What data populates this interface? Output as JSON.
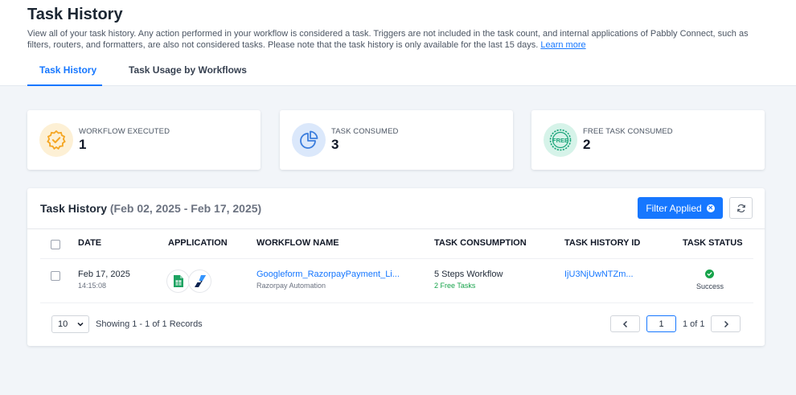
{
  "header": {
    "title": "Task History",
    "description": "View all of your task history. Any action performed in your workflow is considered a task. Triggers are not included in the task count, and internal applications of Pabbly Connect, such as filters, routers, and formatters, are also not considered tasks. Please note that the task history is only available for the last 15 days.",
    "learn_more": "Learn more"
  },
  "tabs": [
    {
      "label": "Task History",
      "active": true
    },
    {
      "label": "Task Usage by Workflows",
      "active": false
    }
  ],
  "stats": [
    {
      "label": "WORKFLOW EXECUTED",
      "value": "1",
      "icon": "badge-check-icon",
      "color": "#f5a623",
      "bg": "#fdf0d5"
    },
    {
      "label": "TASK CONSUMED",
      "value": "3",
      "icon": "pie-chart-icon",
      "color": "#3b7ddd",
      "bg": "#dbe8fb"
    },
    {
      "label": "FREE TASK CONSUMED",
      "value": "2",
      "icon": "free-badge-icon",
      "color": "#1aa57a",
      "bg": "#d6f3e9"
    }
  ],
  "panel": {
    "title": "Task History",
    "range": "(Feb 02, 2025 - Feb 17, 2025)",
    "filter_label": "Filter Applied"
  },
  "table": {
    "columns": [
      "DATE",
      "APPLICATION",
      "WORKFLOW NAME",
      "TASK CONSUMPTION",
      "TASK HISTORY ID",
      "TASK STATUS"
    ],
    "rows": [
      {
        "date": "Feb 17, 2025",
        "time": "14:15:08",
        "apps": [
          "google-sheets-icon",
          "razorpay-icon"
        ],
        "workflow_name": "Googleform_RazorpayPayment_Li...",
        "workflow_sub": "Razorpay Automation",
        "consumption": "5 Steps Workflow",
        "free_tasks": "2 Free Tasks",
        "history_id": "IjU3NjUwNTZm...",
        "status": "Success"
      }
    ]
  },
  "footer": {
    "page_size": "10",
    "showing": "Showing 1 - 1 of 1 Records",
    "page": "1",
    "of": "1 of 1"
  }
}
